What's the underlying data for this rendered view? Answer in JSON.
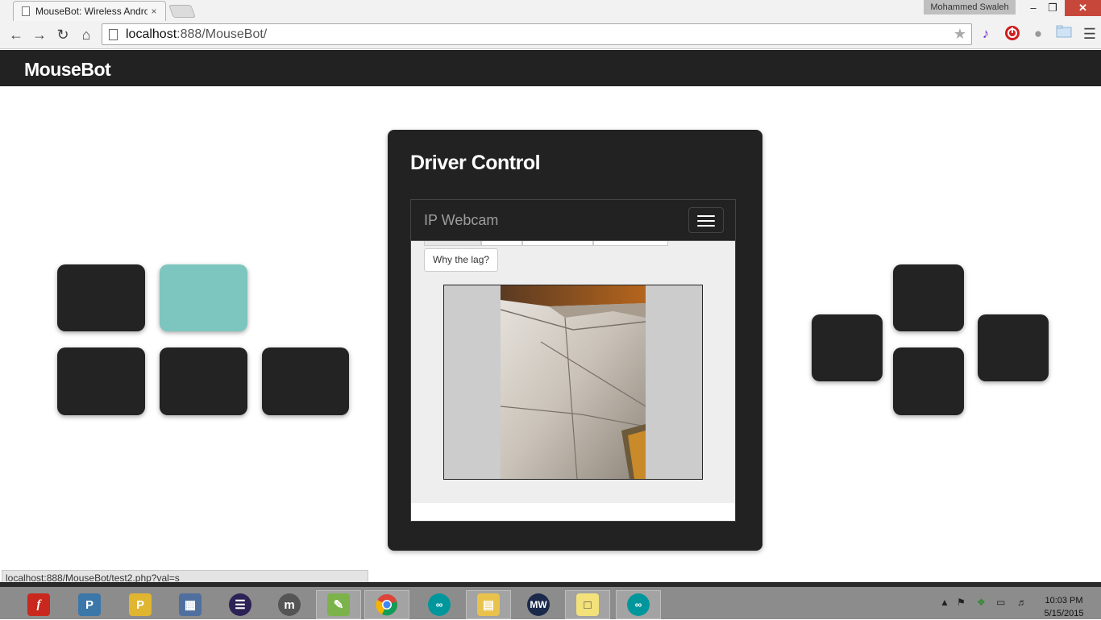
{
  "browser": {
    "tab_title": "MouseBot: Wireless Andro",
    "tab_close": "×",
    "user_name": "Mohammed Swaleh",
    "window_min": "–",
    "window_max": "❐",
    "window_close": "✕",
    "url_host": "localhost",
    "url_path": ":888/MouseBot/",
    "status_url": "localhost:888/MouseBot/test2.php?val=s"
  },
  "site": {
    "brand": "MouseBot"
  },
  "panel": {
    "title": "Driver Control",
    "webcam_brand": "IP Webcam",
    "lag_button": "Why the lag?"
  },
  "left_pad": {
    "active_key": "top-middle"
  },
  "taskbar": {
    "time": "10:03 PM",
    "date": "5/15/2015"
  },
  "colors": {
    "accent": "#7cc6bf",
    "dark": "#222222",
    "taskbar": "#8c8c8c"
  }
}
